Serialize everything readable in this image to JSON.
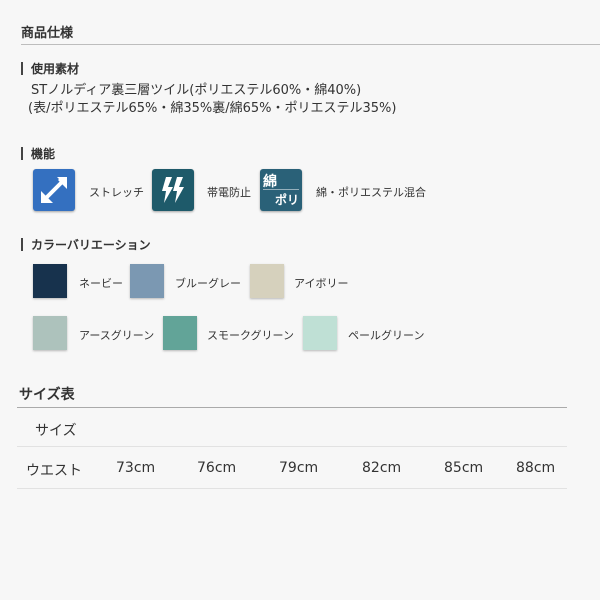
{
  "product_spec": {
    "title": "商品仕様"
  },
  "material": {
    "title": "使用素材",
    "line1": "STノルディア裏三層ツイル(ポリエステル60%・綿40%)",
    "line2": "(表/ポリエステル65%・綿35%裏/綿65%・ポリエステル35%)"
  },
  "features": {
    "title": "機能",
    "items": [
      {
        "label": "ストレッチ",
        "icon": "stretch-arrow-icon",
        "color": "#3470c0"
      },
      {
        "label": "帯電防止",
        "icon": "antistatic-icon",
        "color": "#1e5a6a"
      },
      {
        "label": "綿・ポリエステル混合",
        "icon": "cotton-poly-icon",
        "color": "#2a6178",
        "icon_text_1": "綿",
        "icon_text_2": "ポリ"
      }
    ]
  },
  "colors": {
    "title": "カラーバリエーション",
    "items": [
      {
        "label": "ネービー",
        "color": "#17324d"
      },
      {
        "label": "ブルーグレー",
        "color": "#7b98b2"
      },
      {
        "label": "アイボリー",
        "color": "#d6d1bd"
      },
      {
        "label": "アースグリーン",
        "color": "#adc2bc"
      },
      {
        "label": "スモークグリーン",
        "color": "#62a498"
      },
      {
        "label": "ペールグリーン",
        "color": "#bfe0d5"
      }
    ]
  },
  "size_table": {
    "title": "サイズ表",
    "header": "サイズ",
    "row_label": "ウエスト",
    "values": [
      "73cm",
      "76cm",
      "79cm",
      "82cm",
      "85cm",
      "88cm"
    ]
  }
}
